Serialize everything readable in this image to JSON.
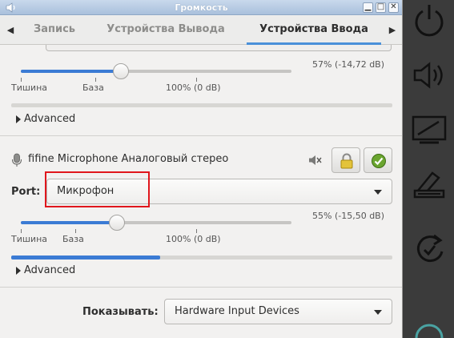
{
  "window": {
    "title": "Громкость",
    "controls": {
      "minimize": "▁",
      "maximize": "□",
      "close": "✕"
    }
  },
  "tabs": [
    {
      "label": "Запись",
      "active": false
    },
    {
      "label": "Устройства Вывода",
      "active": false
    },
    {
      "label": "Устройства Ввода",
      "active": true
    }
  ],
  "device_top": {
    "volume_text": "57% (-14,72 dB)",
    "volume_percent": 57,
    "scale": {
      "silence": "Тишина",
      "base": "База",
      "zero": "100% (0 dB)"
    },
    "level_fraction": 0.0,
    "advanced_label": "Advanced"
  },
  "device_main": {
    "name": "fifine Microphone Аналоговый стерео",
    "port_label": "Port:",
    "port_value": "Микрофон",
    "volume_text": "55% (-15,50 dB)",
    "volume_percent": 55,
    "scale": {
      "silence": "Тишина",
      "base": "База",
      "zero": "100% (0 dB)"
    },
    "level_fraction": 0.39,
    "advanced_label": "Advanced"
  },
  "footer": {
    "show_label": "Показывать:",
    "show_value": "Hardware Input Devices"
  },
  "icons": {
    "mute": "speaker-muted-icon",
    "lock": "lock-icon",
    "default": "check-icon",
    "mic": "microphone-icon"
  },
  "colors": {
    "accent": "#3b7bd4",
    "highlight": "#e0161c",
    "titlebar": "#a9c0dc"
  },
  "dock": [
    "power-icon",
    "speaker-icon",
    "display-icon",
    "scanner-icon",
    "update-icon"
  ]
}
